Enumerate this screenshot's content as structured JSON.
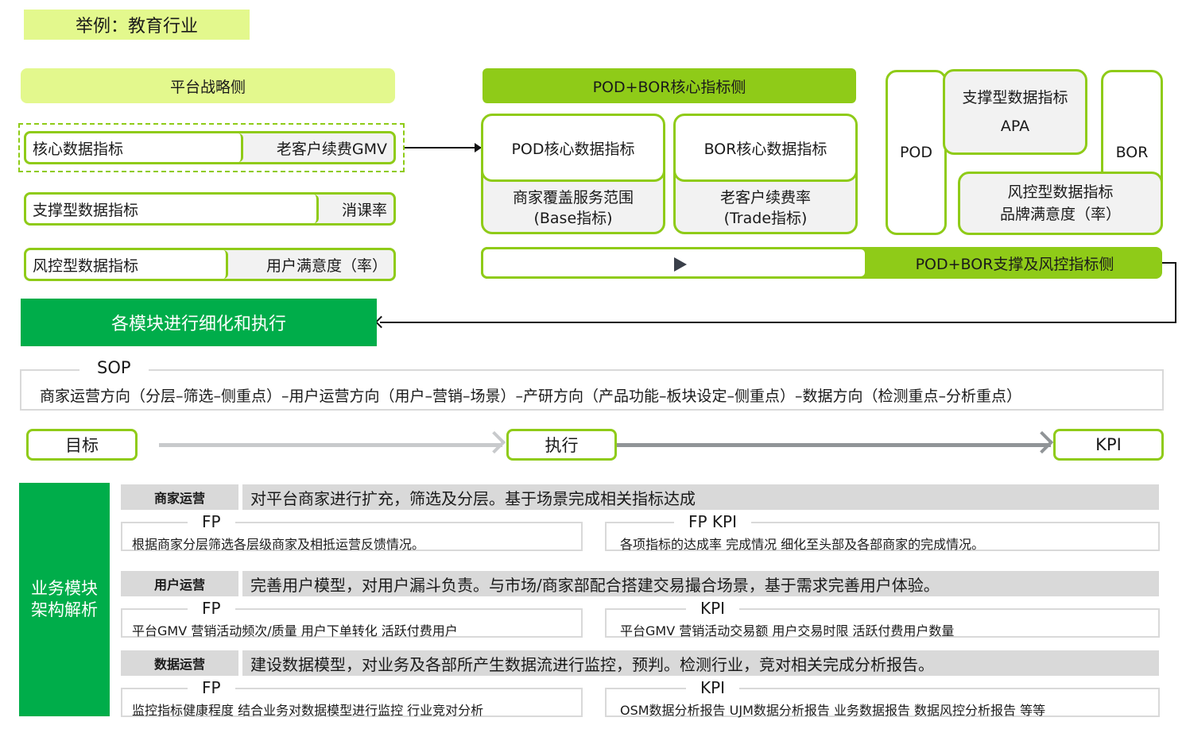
{
  "example_tag": "举例：教育行业",
  "platform": {
    "header": "平台战略侧",
    "rows": [
      {
        "left": "核心数据指标",
        "right": "老客户续费GMV"
      },
      {
        "left": "支撑型数据指标",
        "right": "消课率"
      },
      {
        "left": "风控型数据指标",
        "right": "用户满意度（率）"
      }
    ]
  },
  "podbor_core": {
    "header": "POD+BOR核心指标侧",
    "cards": [
      {
        "title": "POD核心数据指标",
        "line1": "商家覆盖服务范围",
        "line2": "(Base指标)"
      },
      {
        "title": "BOR核心数据指标",
        "line1": "老客户续费率",
        "line2": "(Trade指标)"
      }
    ]
  },
  "podbor_support": {
    "pod": "POD",
    "bor": "BOR",
    "apa_title": "支撑型数据指标",
    "apa_value": "APA",
    "risk_title": "风控型数据指标",
    "risk_value": "品牌满意度（率）",
    "bar_label": "POD+BOR支撑及风控指标侧",
    "play_icon": "play-icon"
  },
  "execute_banner": "各模块进行细化和执行",
  "sop": {
    "title": "SOP",
    "text": "商家运营方向（分层–筛选–侧重点）–用户运营方向（用户–营销–场景）–产研方向（产品功能–板块设定–侧重点）–数据方向（检测重点–分析重点）"
  },
  "flow": {
    "goal": "目标",
    "execute": "执行",
    "kpi": "KPI"
  },
  "modules": {
    "side_line1": "业务模块",
    "side_line2": "架构解析",
    "items": [
      {
        "label": "商家运营",
        "desc": "对平台商家进行扩充，筛选及分层。基于场景完成相关指标达成",
        "left_title": "FP",
        "left_text": "根据商家分层筛选各层级商家及相抵运营反馈情况。",
        "right_title": "FP KPI",
        "right_text": "各项指标的达成率 完成情况 细化至头部及各部商家的完成情况。"
      },
      {
        "label": "用户运营",
        "desc": "完善用户模型，对用户漏斗负责。与市场/商家部配合搭建交易撮合场景，基于需求完善用户体验。",
        "left_title": "FP",
        "left_text": "平台GMV  营销活动频次/质量  用户下单转化 活跃付费用户",
        "right_title": "KPI",
        "right_text": "平台GMV  营销活动交易额  用户交易时限  活跃付费用户数量"
      },
      {
        "label": "数据运营",
        "desc": "建设数据模型，对业务及各部所产生数据流进行监控，预判。检测行业，竞对相关完成分析报告。",
        "left_title": "FP",
        "left_text": "监控指标健康程度 结合业务对数据模型进行监控 行业竞对分析",
        "right_title": "KPI",
        "right_text": "OSM数据分析报告 UJM数据分析报告 业务数据报告 数据风控分析报告 等等"
      }
    ]
  },
  "colors": {
    "light_green": "#e3f88d",
    "lime": "#8fcb18",
    "green": "#00ad4a",
    "gray": "#d9d9d9"
  }
}
